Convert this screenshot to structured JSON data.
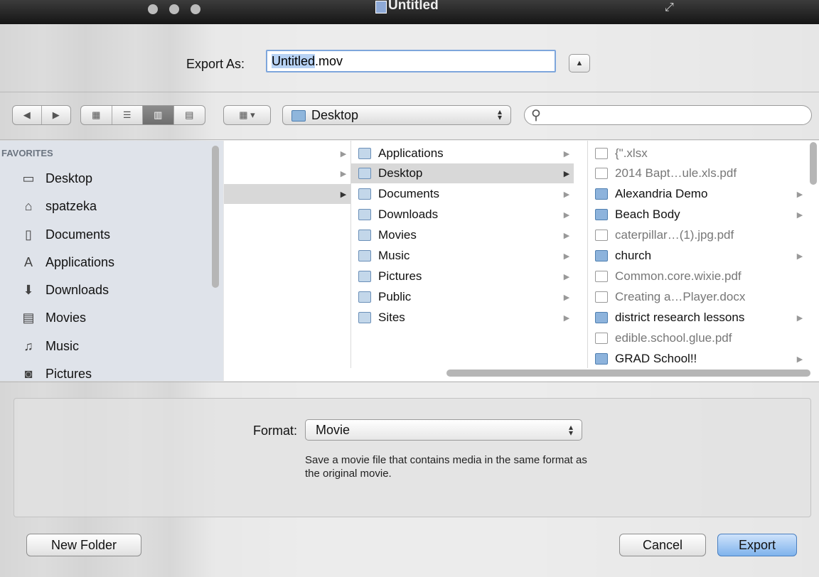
{
  "window": {
    "title": "Untitled"
  },
  "export": {
    "label": "Export As:",
    "filename_selected": "Untitled",
    "filename_ext": ".mov"
  },
  "toolbar": {
    "location": "Desktop",
    "search_placeholder": ""
  },
  "sidebar": {
    "heading": "FAVORITES",
    "items": [
      {
        "label": "Desktop",
        "icon": "desktop-icon"
      },
      {
        "label": "spatzeka",
        "icon": "home-icon"
      },
      {
        "label": "Documents",
        "icon": "documents-icon"
      },
      {
        "label": "Applications",
        "icon": "applications-icon"
      },
      {
        "label": "Downloads",
        "icon": "downloads-icon"
      },
      {
        "label": "Movies",
        "icon": "movies-icon"
      },
      {
        "label": "Music",
        "icon": "music-icon"
      },
      {
        "label": "Pictures",
        "icon": "pictures-icon"
      }
    ]
  },
  "column2": {
    "items": [
      "Applications",
      "Desktop",
      "Documents",
      "Downloads",
      "Movies",
      "Music",
      "Pictures",
      "Public",
      "Sites"
    ]
  },
  "column3": {
    "items": [
      {
        "name": "{\".xlsx",
        "folder": false
      },
      {
        "name": "2014 Bapt…ule.xls.pdf",
        "folder": false
      },
      {
        "name": "Alexandria Demo",
        "folder": true
      },
      {
        "name": "Beach Body",
        "folder": true
      },
      {
        "name": "caterpillar…(1).jpg.pdf",
        "folder": false
      },
      {
        "name": "church",
        "folder": true
      },
      {
        "name": "Common.core.wixie.pdf",
        "folder": false
      },
      {
        "name": "Creating a…Player.docx",
        "folder": false
      },
      {
        "name": "district research lessons",
        "folder": true
      },
      {
        "name": "edible.school.glue.pdf",
        "folder": false
      },
      {
        "name": "GRAD School!!",
        "folder": true
      }
    ]
  },
  "format": {
    "label": "Format:",
    "value": "Movie",
    "description": "Save a movie file that contains media in the same format as the original movie."
  },
  "buttons": {
    "new_folder": "New Folder",
    "cancel": "Cancel",
    "export": "Export"
  }
}
